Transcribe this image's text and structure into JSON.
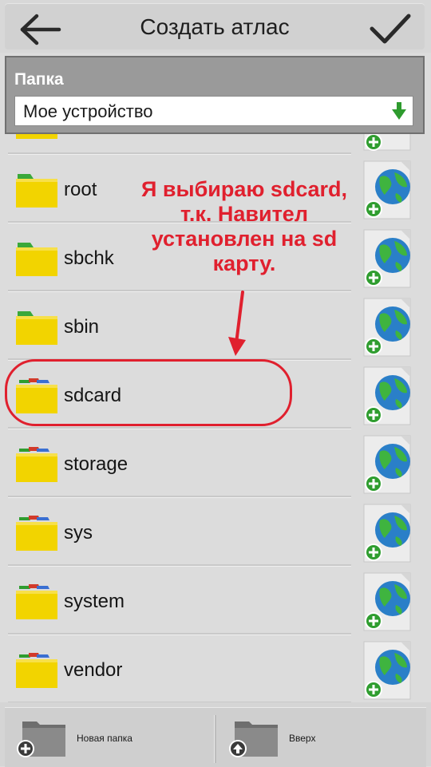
{
  "header": {
    "title": "Создать атлас",
    "back_icon": "arrow-left-icon",
    "confirm_icon": "checkmark-icon"
  },
  "folder_picker": {
    "label": "Папка",
    "selected": "Мое устройство",
    "arrow_color": "#2e9b2e"
  },
  "list": {
    "items": [
      {
        "name": "root",
        "folder_style": "plain"
      },
      {
        "name": "sbchk",
        "folder_style": "plain"
      },
      {
        "name": "sbin",
        "folder_style": "plain"
      },
      {
        "name": "sdcard",
        "folder_style": "tabs"
      },
      {
        "name": "storage",
        "folder_style": "tabs"
      },
      {
        "name": "sys",
        "folder_style": "tabs"
      },
      {
        "name": "system",
        "folder_style": "tabs"
      },
      {
        "name": "vendor",
        "folder_style": "tabs"
      }
    ],
    "row_action_icon": "globe-add-icon"
  },
  "annotation": {
    "line1": "Я выбираю sdcard,",
    "line2": "т.к. Навител",
    "line3": "установлен на sd",
    "line4": "карту.",
    "color": "#e0202e"
  },
  "footer": {
    "new_folder_label": "Новая папка",
    "up_label": "Вверх"
  }
}
